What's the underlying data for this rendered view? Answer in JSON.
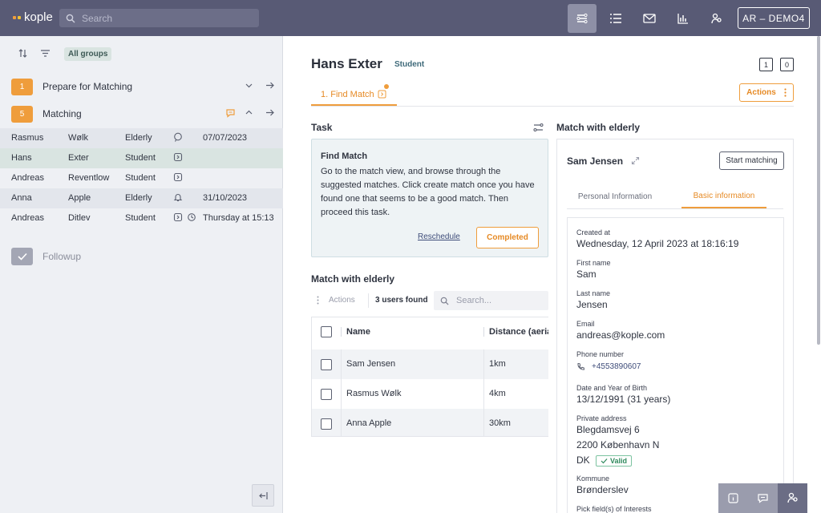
{
  "app": {
    "logo_text": "kople",
    "brand_colors": [
      "#ef9d3c",
      "#f1c232"
    ]
  },
  "topbar": {
    "search_placeholder": "Search",
    "icons": [
      "tasks-icon",
      "list-icon",
      "mail-icon",
      "chart-icon",
      "users-icon"
    ],
    "user_label": "AR – DEMO4"
  },
  "sidebar": {
    "filter_chip": "All groups",
    "groups": [
      {
        "count": "1",
        "title": "Prepare for Matching"
      },
      {
        "count": "5",
        "title": "Matching"
      }
    ],
    "users": [
      {
        "first": "Rasmus",
        "last": "Wølk",
        "role": "Elderly",
        "date": "07/07/2023"
      },
      {
        "first": "Hans",
        "last": "Exter",
        "role": "Student",
        "date": ""
      },
      {
        "first": "Andreas",
        "last": "Reventlow",
        "role": "Student",
        "date": ""
      },
      {
        "first": "Anna",
        "last": "Apple",
        "role": "Elderly",
        "date": "31/10/2023"
      },
      {
        "first": "Andreas",
        "last": "Ditlev",
        "role": "Student",
        "date": "Thursday at 15:13"
      }
    ],
    "followup_label": "Followup"
  },
  "profile": {
    "name": "Hans Exter",
    "role": "Student",
    "pager": [
      "1",
      "0"
    ],
    "tab_label": "1.  Find Match",
    "actions_label": "Actions"
  },
  "task": {
    "section_title": "Task",
    "title": "Find Match",
    "description": "Go to the match view, and browse through the suggested matches. Click create match once you have found one that seems to be a good match. Then proceed this task.",
    "reschedule_label": "Reschedule",
    "completed_label": "Completed"
  },
  "match_list": {
    "section_title": "Match with elderly",
    "actions_label": "Actions",
    "count_label": "3 users found",
    "search_placeholder": "Search...",
    "columns": [
      "Name",
      "Distance (aeria"
    ],
    "rows": [
      {
        "name": "Sam Jensen",
        "distance": "1km"
      },
      {
        "name": "Rasmus Wølk",
        "distance": "4km"
      },
      {
        "name": "Anna Apple",
        "distance": "30km"
      }
    ]
  },
  "match_card": {
    "section_title": "Match with elderly",
    "name": "Sam Jensen",
    "start_label": "Start matching",
    "tabs": [
      "Personal Information",
      "Basic information"
    ],
    "fields": {
      "created_label": "Created at",
      "created_value": "Wednesday, 12 April 2023 at 18:16:19",
      "first_label": "First name",
      "first_value": "Sam",
      "last_label": "Last name",
      "last_value": "Jensen",
      "email_label": "Email",
      "email_value": "andreas@kople.com",
      "phone_label": "Phone number",
      "phone_value": "+4553890607",
      "dob_label": "Date and Year of Birth",
      "dob_value": "13/12/1991 (31 years)",
      "address_label": "Private address",
      "address_line1": "Blegdamsvej 6",
      "address_line2": "2200 København N",
      "address_country": "DK",
      "valid_label": "Valid",
      "kommune_label": "Kommune",
      "kommune_value": "Brønderslev",
      "interests_label": "Pick field(s) of Interests"
    }
  }
}
